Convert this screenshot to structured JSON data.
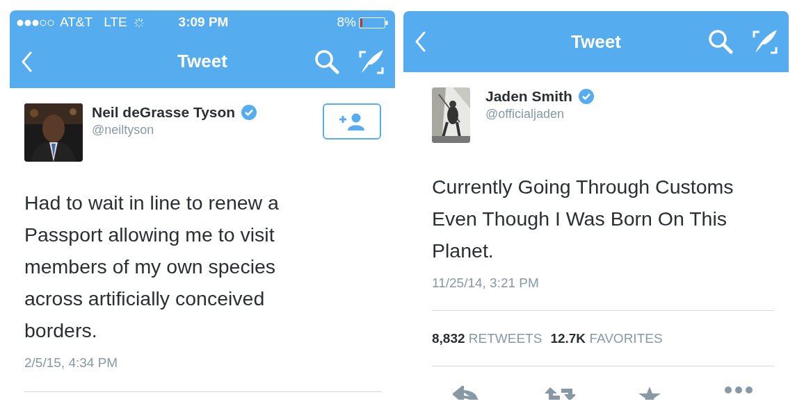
{
  "panels": [
    {
      "status_bar": {
        "carrier": "AT&T",
        "network": "LTE",
        "time": "3:09 PM",
        "battery": "8%"
      },
      "nav": {
        "title": "Tweet"
      },
      "tweet": {
        "name": "Neil deGrasse Tyson",
        "handle": "@neiltyson",
        "verified": true,
        "follow_button": true,
        "text": "Had to wait in line to renew a Passport allowing me to visit members of my own species across artificially conceived borders.",
        "timestamp": "2/5/15, 4:34 PM"
      }
    },
    {
      "nav": {
        "title": "Tweet"
      },
      "tweet": {
        "name": "Jaden Smith",
        "handle": "@officialjaden",
        "verified": true,
        "follow_button": false,
        "text": "Currently Going Through Customs Even Though I Was Born On This Planet.",
        "timestamp": "11/25/14, 3:21 PM",
        "stats": [
          {
            "count": "8,832",
            "label": "RETWEETS"
          },
          {
            "count": "12.7K",
            "label": "FAVORITES"
          }
        ],
        "actions": [
          {
            "kind": "reply"
          },
          {
            "kind": "retweet"
          },
          {
            "kind": "favorite"
          },
          {
            "kind": "more"
          }
        ]
      }
    }
  ]
}
